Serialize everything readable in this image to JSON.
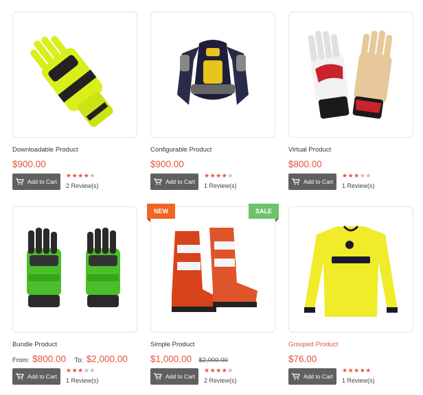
{
  "products": [
    {
      "name": "Downloadable Product",
      "price": "$900.00",
      "button": "Add to Cart",
      "rating": 4,
      "reviews": "2 Review(s)"
    },
    {
      "name": "Configurable Product",
      "price": "$900.00",
      "button": "Add to Cart",
      "rating": 4,
      "reviews": "1 Review(s)"
    },
    {
      "name": "Virtual Product",
      "price": "$800.00",
      "button": "Add to Cart",
      "rating": 3.5,
      "reviews": "1 Review(s)"
    },
    {
      "name": "Bundle Product",
      "from_label": "From:",
      "from_price": "$800.00",
      "to_label": "To:",
      "to_price": "$2,000.00",
      "button": "Add to Cart",
      "rating": 3,
      "reviews": "1 Review(s)"
    },
    {
      "name": "Simple Product",
      "price": "$1,000.00",
      "old_price": "$2,000.00",
      "badge_new": "NEW",
      "badge_sale": "SALE",
      "button": "Add to Cart",
      "rating": 4,
      "reviews": "2 Review(s)"
    },
    {
      "name": "Grouped Product",
      "price": "$76.00",
      "button": "Add to Cart",
      "rating": 5,
      "reviews": "1 Review(s)"
    }
  ],
  "colors": {
    "accent": "#e2533a",
    "button": "#606060",
    "badge_new": "#f06424",
    "badge_sale": "#6ec26b"
  }
}
